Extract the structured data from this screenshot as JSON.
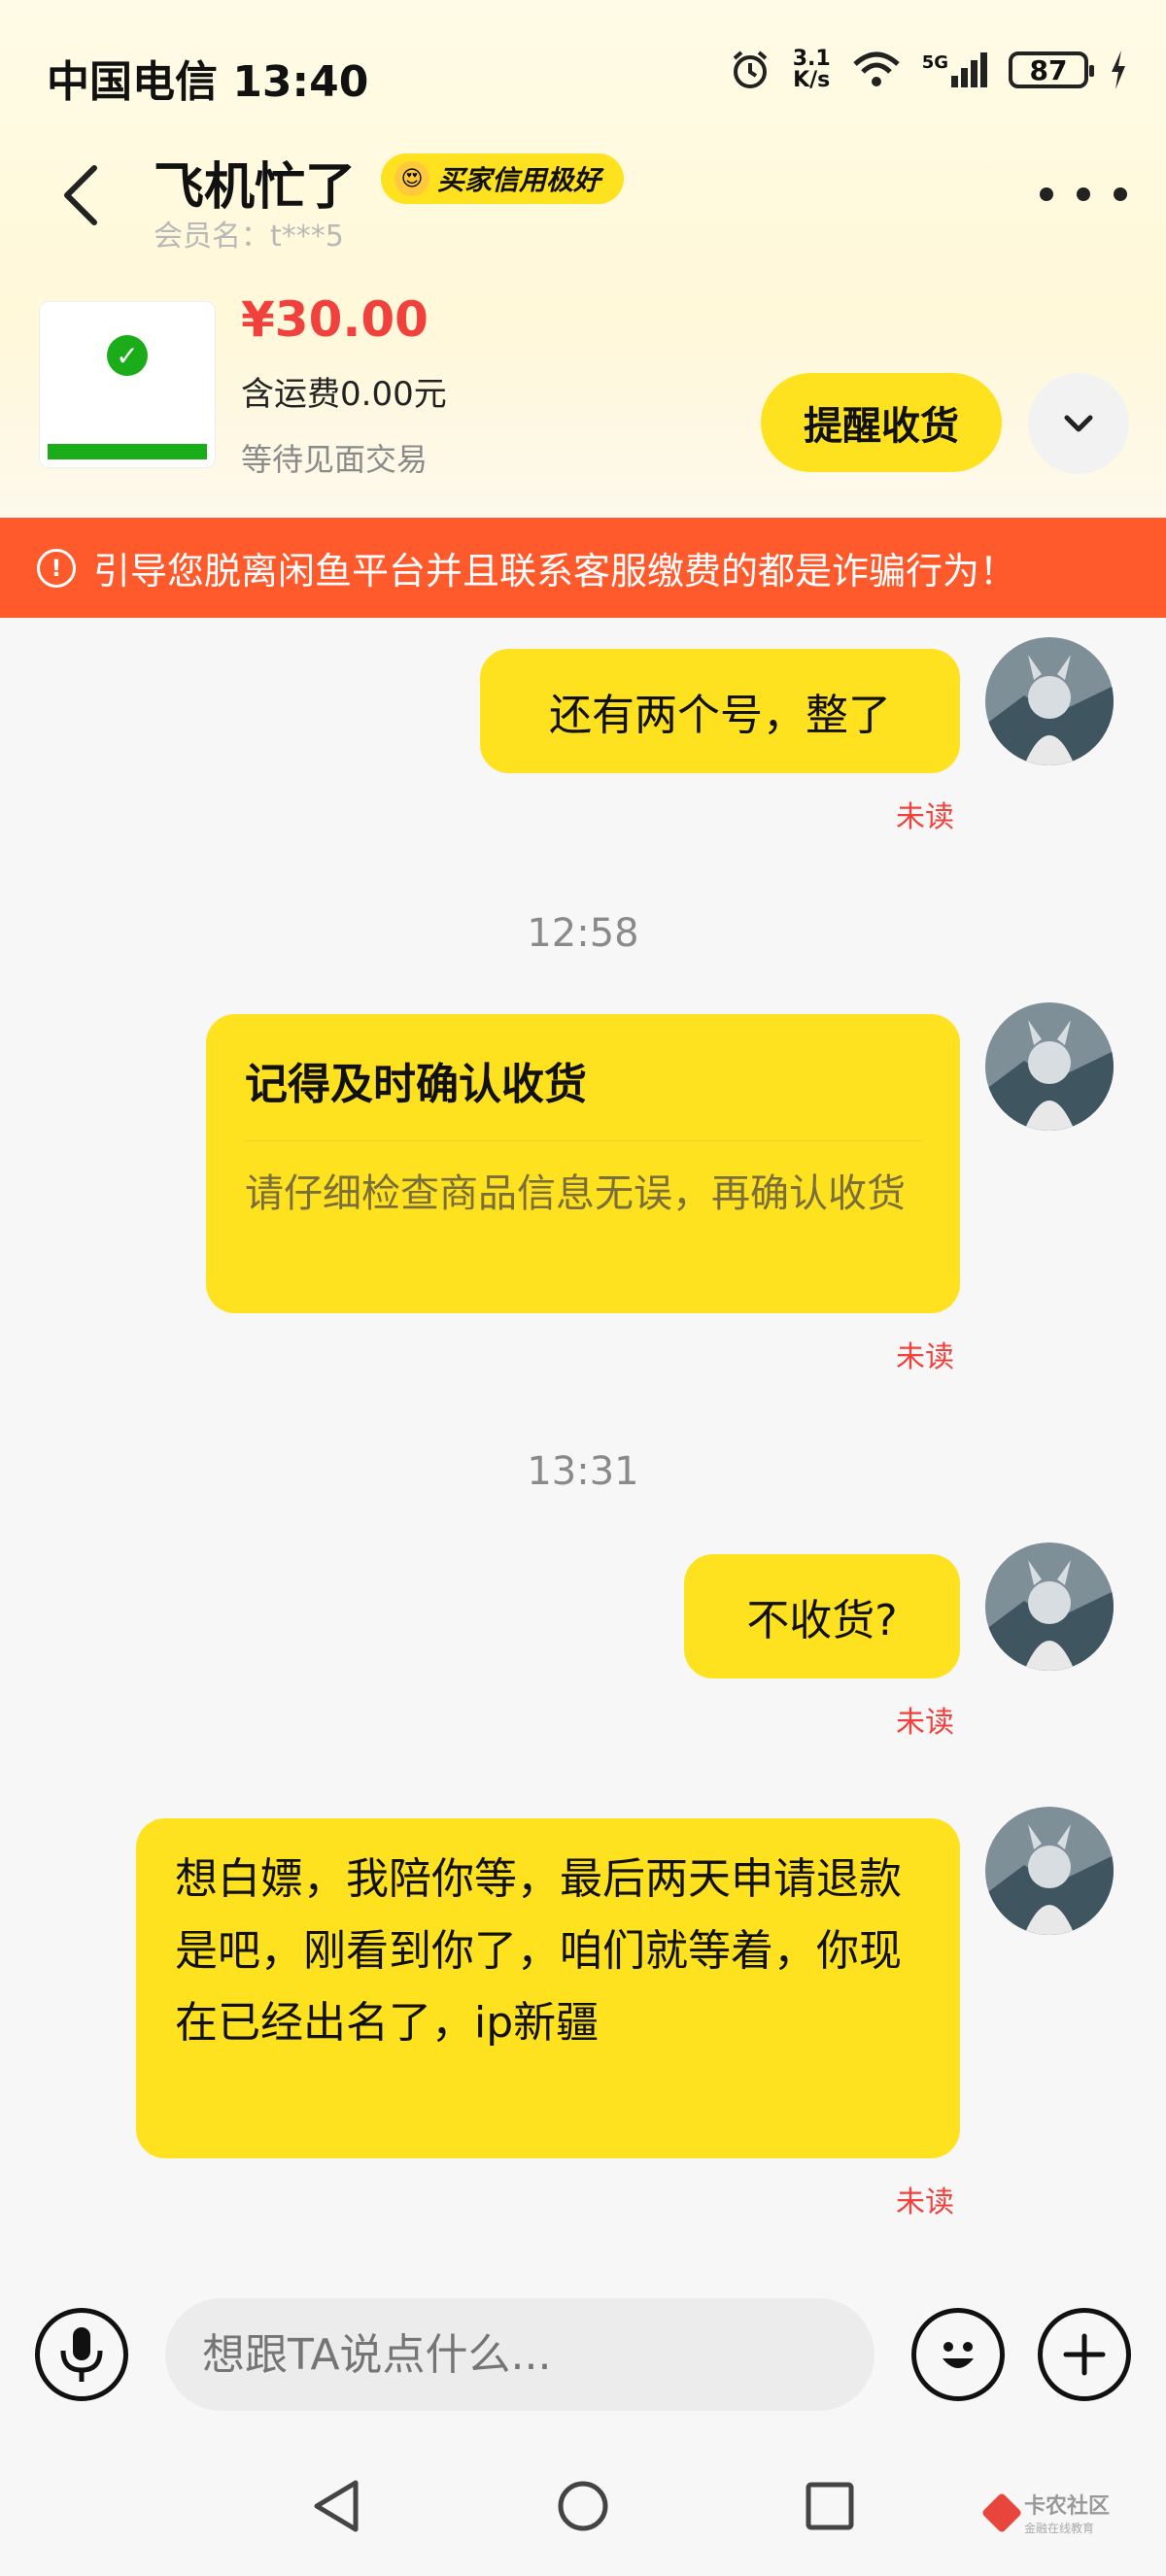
{
  "status_bar": {
    "carrier_time": "中国电信 13:40",
    "net_speed_top": "3.1",
    "net_speed_unit": "K/s",
    "network": "5G",
    "battery": "87"
  },
  "header": {
    "name": "飞机忙了",
    "credit_badge": "买家信用极好",
    "member_label": "会员名：t***5"
  },
  "product": {
    "price": "¥30.00",
    "shipping": "含运费0.00元",
    "status": "等待见面交易",
    "remind_button": "提醒收货"
  },
  "warning": {
    "text": "引导您脱离闲鱼平台并且联系客服缴费的都是诈骗行为！"
  },
  "messages": [
    {
      "text": "还有两个号，整了",
      "status": "未读"
    },
    {
      "timestamp": "12:58"
    },
    {
      "card_title": "记得及时确认收货",
      "card_sub": "请仔细检查商品信息无误，再确认收货",
      "status": "未读"
    },
    {
      "timestamp": "13:31"
    },
    {
      "text": "不收货?",
      "status": "未读"
    },
    {
      "text": "想白嫖，我陪你等，最后两天申请退款是吧，刚看到你了，咱们就等着，你现在已经出名了，ip新疆",
      "status": "未读"
    }
  ],
  "input": {
    "placeholder": "想跟TA说点什么..."
  },
  "watermark": {
    "title": "卡农社区",
    "subtitle": "金融在线教育"
  },
  "colors": {
    "accent_yellow": "#ffe21f",
    "warning_orange": "#ff5a2c",
    "price_red": "#f0413c"
  }
}
